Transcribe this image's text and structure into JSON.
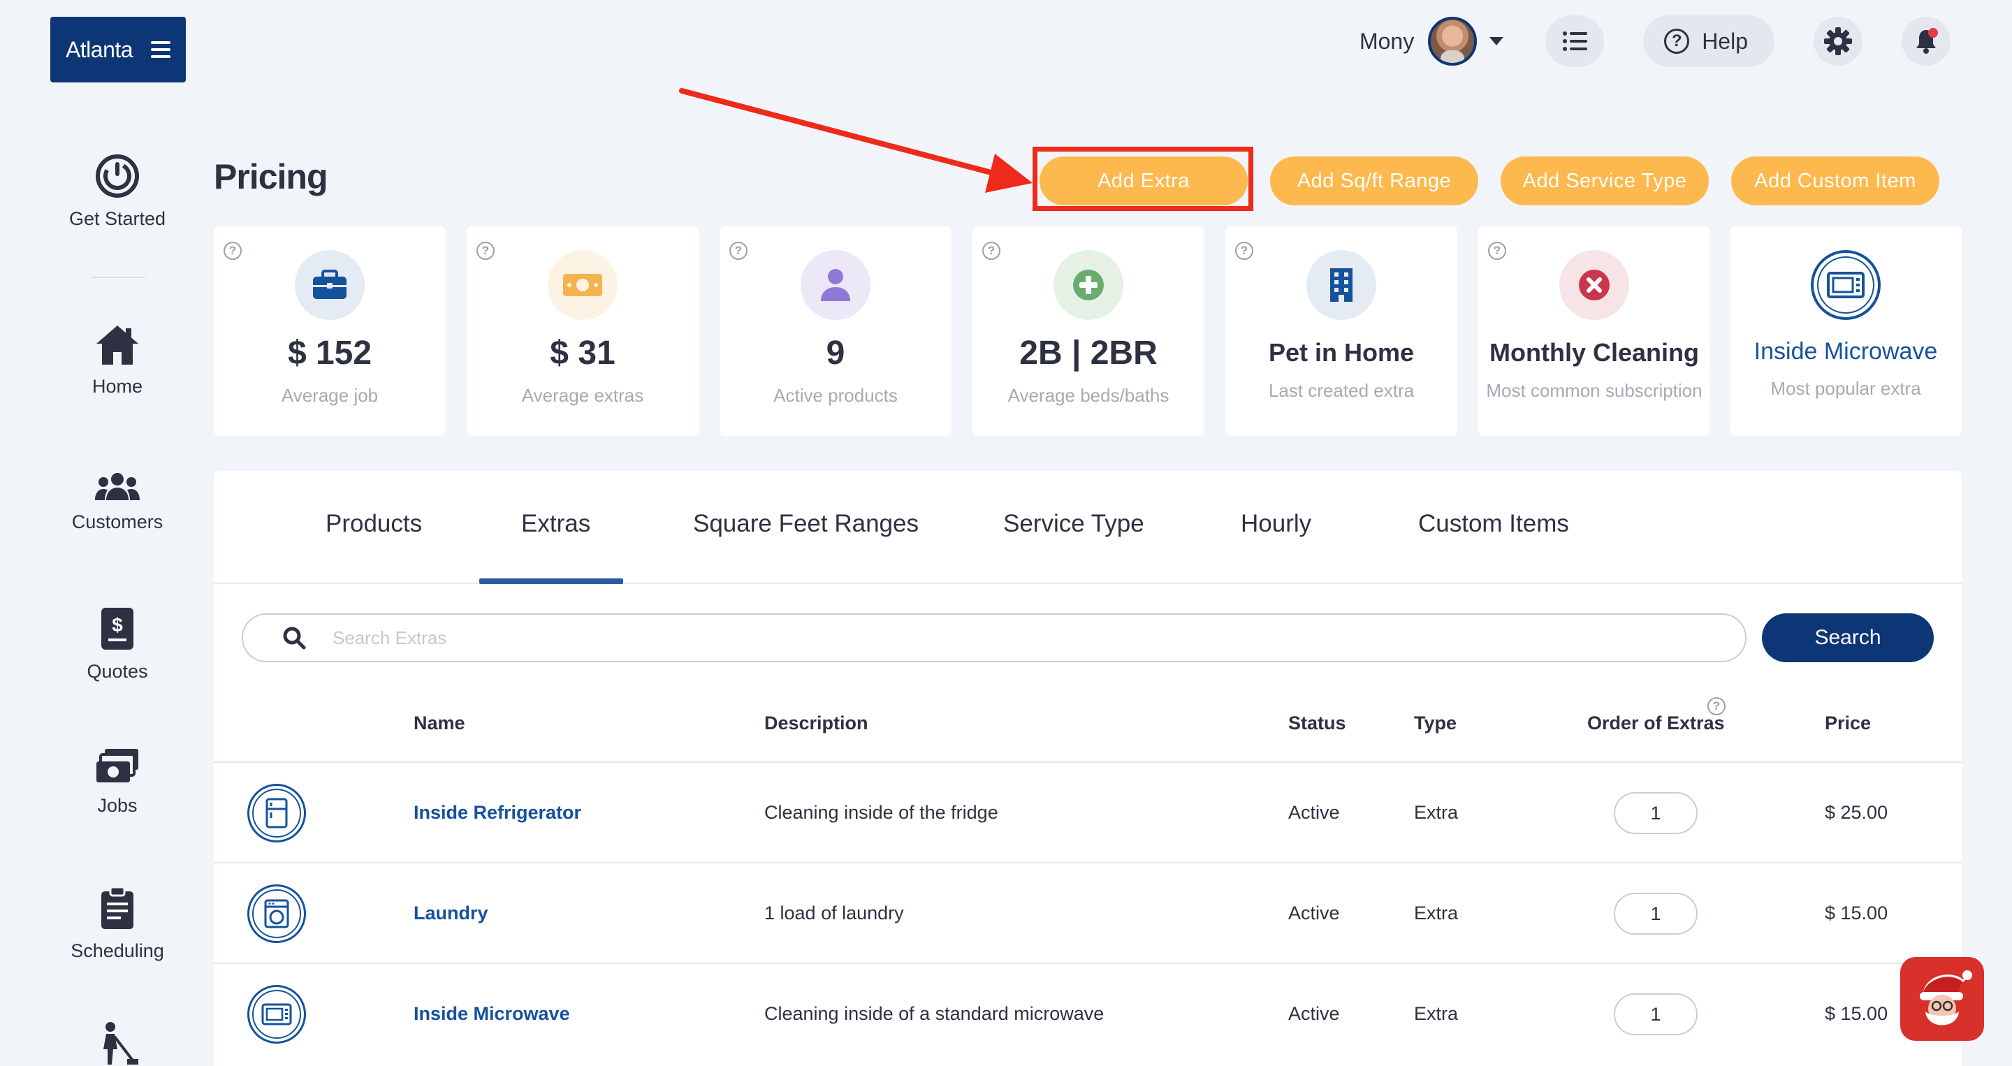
{
  "brand": {
    "city": "Atlanta"
  },
  "topbar": {
    "user_name": "Mony",
    "help_label": "Help"
  },
  "sidebar": {
    "items": [
      {
        "label": "Get Started",
        "icon": "power-icon"
      },
      {
        "label": "Home",
        "icon": "home-icon"
      },
      {
        "label": "Customers",
        "icon": "customers-icon"
      },
      {
        "label": "Quotes",
        "icon": "quotes-icon"
      },
      {
        "label": "Jobs",
        "icon": "jobs-icon"
      },
      {
        "label": "Scheduling",
        "icon": "clipboard-icon"
      }
    ]
  },
  "pricing": {
    "title": "Pricing",
    "actions": {
      "add_extra": "Add Extra",
      "add_sqft": "Add Sq/ft Range",
      "add_service": "Add Service Type",
      "add_custom": "Add Custom Item"
    }
  },
  "stats": [
    {
      "value": "$ 152",
      "label": "Average job",
      "icon": "briefcase-icon",
      "icon_bg": "#e4ebf3",
      "icon_color": "#15529c"
    },
    {
      "value": "$ 31",
      "label": "Average extras",
      "icon": "money-icon",
      "icon_bg": "#fdf3e4",
      "icon_color": "#f2b54e"
    },
    {
      "value": "9",
      "label": "Active products",
      "icon": "person-icon",
      "icon_bg": "#ece8f7",
      "icon_color": "#8d7ad6"
    },
    {
      "value": "2B | 2BR",
      "label": "Average beds/baths",
      "icon": "plus-icon",
      "icon_bg": "#e6f1e6",
      "icon_color": "#6aac70"
    },
    {
      "value": "Pet in Home",
      "label": "Last created extra",
      "icon": "building-icon",
      "icon_bg": "#e4ebf3",
      "icon_color": "#15529c"
    },
    {
      "value": "Monthly Cleaning",
      "label": "Most common subscription",
      "icon": "cancel-icon",
      "icon_bg": "#f6e4e6",
      "icon_color": "#c8374b"
    },
    {
      "value": "Inside Microwave",
      "label": "Most popular extra",
      "icon": "microwave-icon",
      "icon_bg": "#ffffff",
      "icon_color": "#15529c"
    }
  ],
  "tabs": [
    "Products",
    "Extras",
    "Square Feet Ranges",
    "Service Type",
    "Hourly",
    "Custom Items"
  ],
  "search": {
    "placeholder": "Search Extras",
    "button": "Search"
  },
  "table": {
    "headers": {
      "name": "Name",
      "description": "Description",
      "status": "Status",
      "type": "Type",
      "order": "Order of Extras",
      "price": "Price"
    },
    "rows": [
      {
        "icon": "refrigerator-icon",
        "name": "Inside Refrigerator",
        "description": "Cleaning inside of the fridge",
        "status": "Active",
        "type": "Extra",
        "order": "1",
        "price": "$ 25.00"
      },
      {
        "icon": "washing-machine-icon",
        "name": "Laundry",
        "description": "1 load of laundry",
        "status": "Active",
        "type": "Extra",
        "order": "1",
        "price": "$ 15.00"
      },
      {
        "icon": "microwave-icon",
        "name": "Inside Microwave",
        "description": "Cleaning inside of a standard microwave",
        "status": "Active",
        "type": "Extra",
        "order": "1",
        "price": "$ 15.00"
      }
    ]
  },
  "colors": {
    "accent": "#0d3677",
    "action": "#fdb94e",
    "highlight": "#ee2a1b",
    "link": "#15529c"
  }
}
